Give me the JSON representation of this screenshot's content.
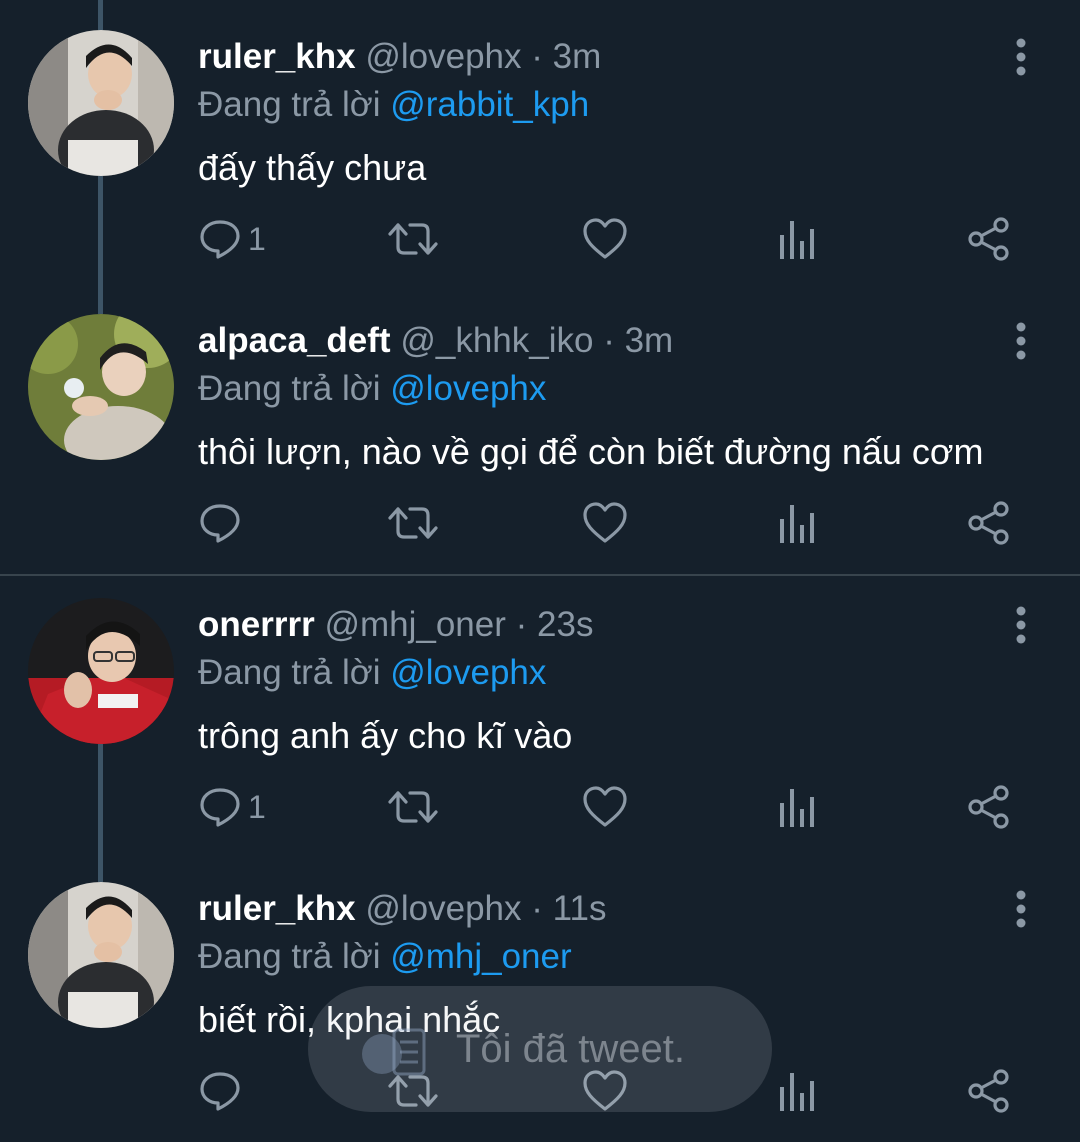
{
  "tweets": [
    {
      "name": "ruler_khx",
      "handle": "@lovephx",
      "time": "3m",
      "reply_prefix": "Đang trả lời",
      "reply_to": "@rabbit_kph",
      "text": "đấy thấy chưa",
      "reply_count": "1"
    },
    {
      "name": "alpaca_deft",
      "handle": "@_khhk_iko",
      "time": "3m",
      "reply_prefix": "Đang trả lời",
      "reply_to": "@lovephx",
      "text": "thôi lượn, nào về gọi để còn biết đường nấu cơm",
      "reply_count": ""
    },
    {
      "name": "onerrrr",
      "handle": "@mhj_oner",
      "time": "23s",
      "reply_prefix": "Đang trả lời",
      "reply_to": "@lovephx",
      "text": "trông anh ấy cho kĩ vào",
      "reply_count": "1"
    },
    {
      "name": "ruler_khx",
      "handle": "@lovephx",
      "time": "11s",
      "reply_prefix": "Đang trả lời",
      "reply_to": "@mhj_oner",
      "text": "biết rồi, kphai nhắc",
      "reply_count": ""
    }
  ],
  "separator": "·",
  "toast": {
    "text": "Tôi đã tweet."
  },
  "colors": {
    "background": "#15202b",
    "mention": "#1d9bf0",
    "muted": "#8b98a5",
    "thread_line": "#3d5466",
    "divider": "#38444d"
  },
  "icons": [
    "reply-icon",
    "retweet-icon",
    "like-icon",
    "analytics-icon",
    "share-icon",
    "more-icon",
    "clipboard-icon"
  ]
}
